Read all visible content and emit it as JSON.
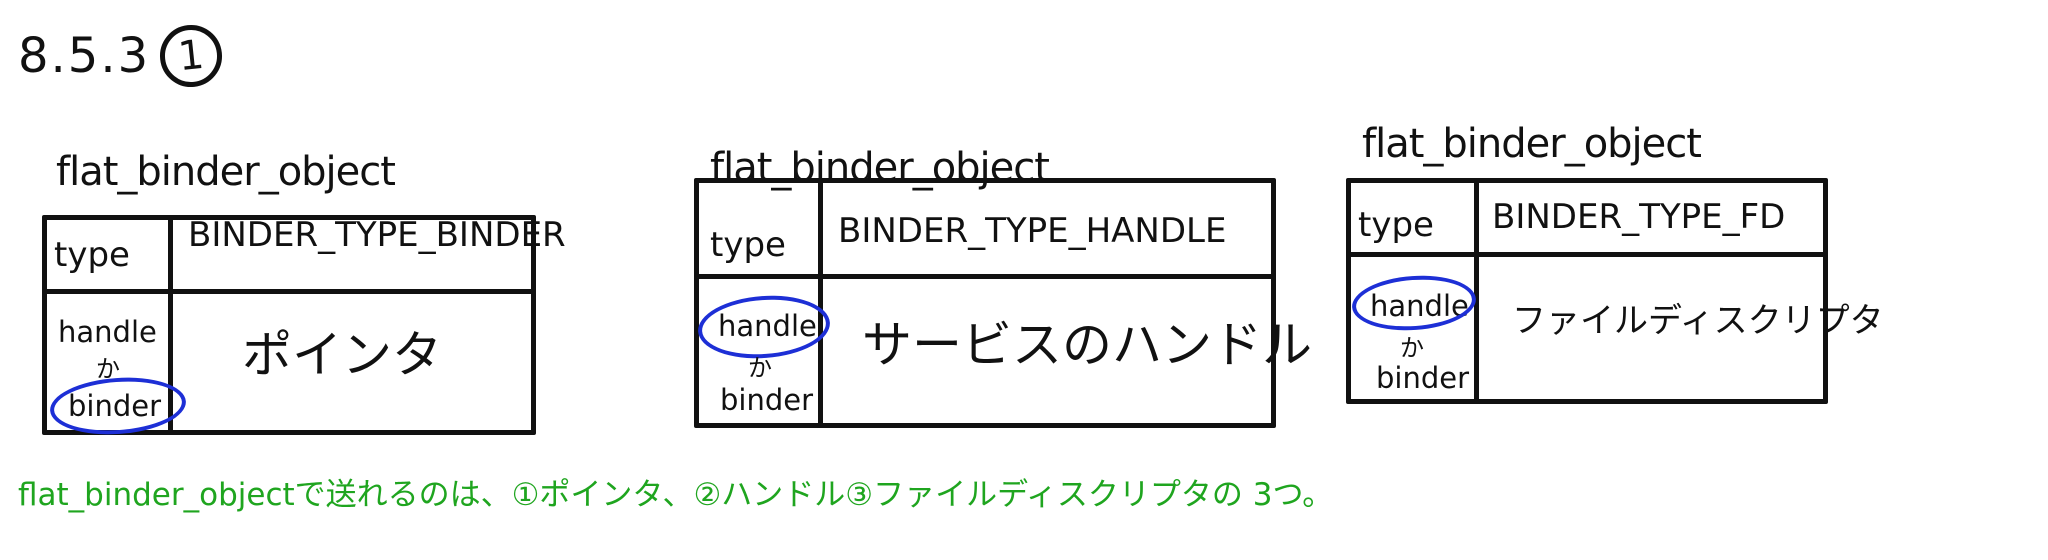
{
  "section": {
    "prefix": "8.5.3",
    "circled_number": "1"
  },
  "tables": [
    {
      "title": "flat_binder_object",
      "type_label": "type",
      "type_value": "BINDER_TYPE_BINDER",
      "handle_label": "handle",
      "or_label": "か",
      "binder_label": "binder",
      "content": "ポインタ"
    },
    {
      "title": "flat_binder_object",
      "type_label": "type",
      "type_value": "BINDER_TYPE_HANDLE",
      "handle_label": "handle",
      "or_label": "か",
      "binder_label": "binder",
      "content": "サービスのハンドル"
    },
    {
      "title": "flat_binder_object",
      "type_label": "type",
      "type_value": "BINDER_TYPE_FD",
      "handle_label": "handle",
      "or_label": "か",
      "binder_label": "binder",
      "content": "ファイルディスクリプタ"
    }
  ],
  "summary": "flat_binder_objectで送れるのは、①ポインタ、②ハンドル③ファイルディスクリプタの 3つ。",
  "colors": {
    "ink": "#111111",
    "highlight": "#1d2fd6",
    "summary": "#1fa51f"
  }
}
